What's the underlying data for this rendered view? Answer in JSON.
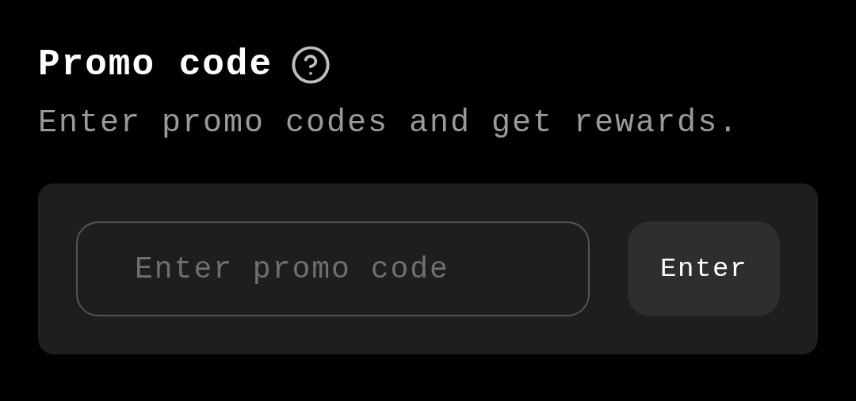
{
  "title": "Promo code",
  "subtitle": "Enter promo codes and get rewards.",
  "promo_field": {
    "placeholder": "Enter promo code"
  },
  "submit_button": {
    "label": "Enter"
  }
}
